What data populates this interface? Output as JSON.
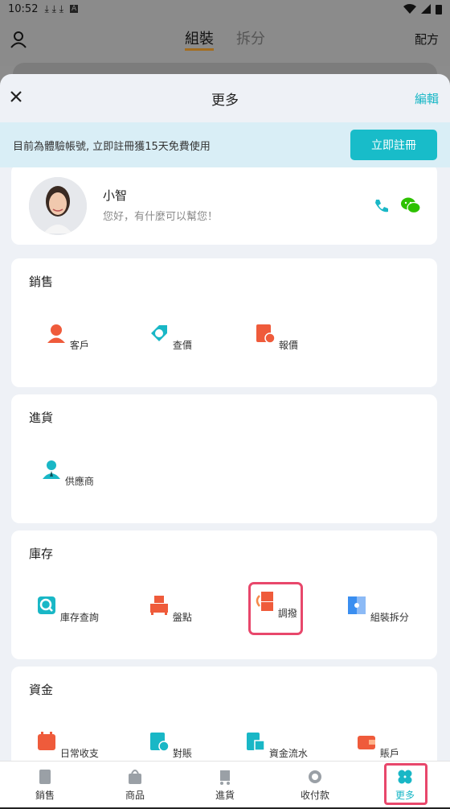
{
  "status_bar": {
    "time": "10:52",
    "downloads": "⤓ ⤓ ⤓",
    "a": "A"
  },
  "background": {
    "tabs": [
      "組裝",
      "拆分"
    ],
    "right_label": "配方"
  },
  "sheet": {
    "title": "更多",
    "edit_label": "編輯",
    "trial_text": "目前為體驗帳號, 立即註冊獲15天免費使用",
    "register_button": "立即註冊",
    "assistant": {
      "name": "小智",
      "greeting": "您好，有什麼可以幫您！"
    },
    "sections": [
      {
        "title": "銷售",
        "items": [
          "客戶",
          "查價",
          "報價"
        ]
      },
      {
        "title": "進貨",
        "items": [
          "供應商"
        ]
      },
      {
        "title": "庫存",
        "items": [
          "庫存查詢",
          "盤點",
          "調撥",
          "組裝拆分"
        ]
      },
      {
        "title": "資金",
        "items": [
          "日常收支",
          "對賬",
          "資金流水",
          "賬戶"
        ]
      }
    ]
  },
  "nav": {
    "items": [
      "銷售",
      "商品",
      "進貨",
      "收付款",
      "更多"
    ],
    "active": "更多"
  },
  "colors": {
    "accent": "#19b7c6",
    "icon_red": "#ef5b3b",
    "highlight": "#e8476b"
  }
}
